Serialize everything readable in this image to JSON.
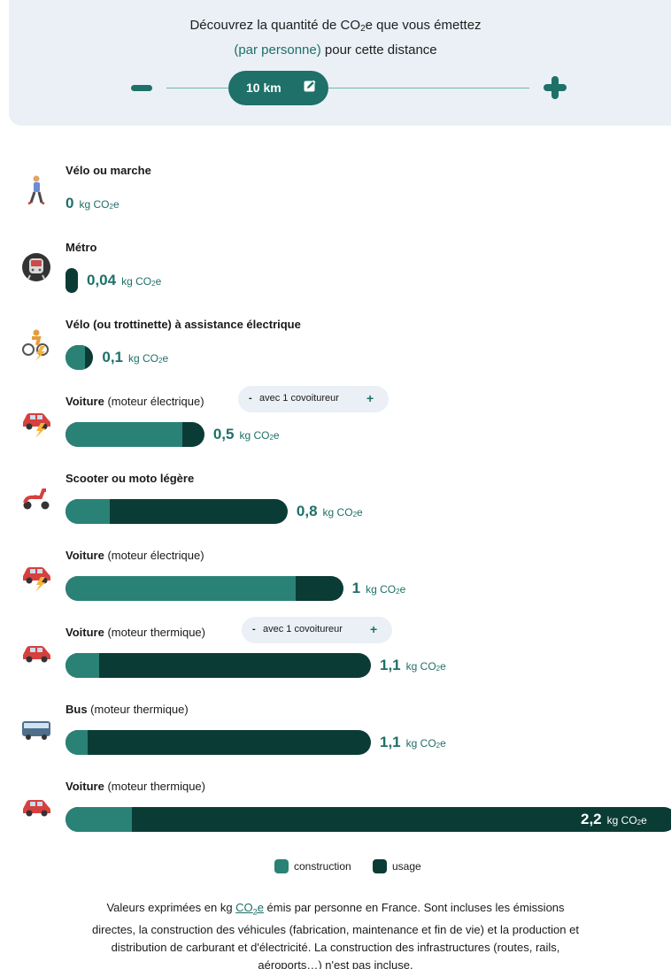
{
  "header": {
    "line1_prefix": "Découvrez la quantité de CO",
    "line1_sub": "2",
    "line1_suffix": "e que vous émettez",
    "line2_accent": "(par personne)",
    "line2_suffix": " pour cette distance"
  },
  "distance": {
    "value": "10 km",
    "min_value_km": 1,
    "icons": {
      "decrease": "minus-icon",
      "increase": "plus-icon",
      "edit": "edit-icon"
    }
  },
  "unit": {
    "prefix": "kg CO",
    "sub": "2",
    "suffix": "e"
  },
  "modes": [
    {
      "label_bold": "Vélo ou marche",
      "label_rest": "",
      "value": "0",
      "construction": 0,
      "usage": 0,
      "icon": "walking-person-icon",
      "covoiturage": null
    },
    {
      "label_bold": "Métro",
      "label_rest": "",
      "value": "0,04",
      "construction": 0,
      "usage": 0.04,
      "icon": "metro-icon",
      "covoiturage": null
    },
    {
      "label_bold": "Vélo (ou trottinette) à assistance électrique",
      "label_rest": "",
      "value": "0,1",
      "construction": 0.07,
      "usage": 0.03,
      "icon": "e-bike-icon",
      "covoiturage": null
    },
    {
      "label_bold": "Voiture",
      "label_rest": " (moteur électrique)",
      "value": "0,5",
      "construction": 0.42,
      "usage": 0.08,
      "icon": "electric-car-icon",
      "covoiturage": {
        "minus": "-",
        "text": "avec 1 covoitureur",
        "plus": "+"
      }
    },
    {
      "label_bold": "Scooter ou moto légère",
      "label_rest": "",
      "value": "0,8",
      "construction": 0.16,
      "usage": 0.64,
      "icon": "scooter-icon",
      "covoiturage": null
    },
    {
      "label_bold": "Voiture",
      "label_rest": " (moteur électrique)",
      "value": "1",
      "construction": 0.83,
      "usage": 0.17,
      "icon": "electric-car-icon",
      "covoiturage": null
    },
    {
      "label_bold": "Voiture",
      "label_rest": " (moteur thermique)",
      "value": "1,1",
      "construction": 0.12,
      "usage": 0.98,
      "icon": "car-icon",
      "covoiturage": {
        "minus": "-",
        "text": "avec 1 covoitureur",
        "plus": "+"
      }
    },
    {
      "label_bold": "Bus",
      "label_rest": " (moteur thermique)",
      "value": "1,1",
      "construction": 0.08,
      "usage": 1.02,
      "icon": "bus-icon",
      "covoiturage": null
    },
    {
      "label_bold": "Voiture",
      "label_rest": " (moteur thermique)",
      "value": "2,2",
      "construction": 0.24,
      "usage": 1.96,
      "icon": "car-icon",
      "covoiturage": null
    }
  ],
  "legend": {
    "construction": "construction",
    "usage": "usage"
  },
  "colors": {
    "construction": "#2a8276",
    "usage": "#0b3b35",
    "accent": "#1e7068",
    "panel": "#eaf0f6"
  },
  "note": {
    "part1": "Valeurs exprimées en kg ",
    "link_prefix": "CO",
    "link_sub": "2",
    "link_suffix": "e",
    "part2": " émis par personne en France. Sont incluses les émissions directes, la construction des véhicules (fabrication, maintenance et fin de vie) et la production et distribution de carburant et d'électricité. La construction des infrastructures (routes, rails, aéroports…) n'est pas incluse."
  }
}
